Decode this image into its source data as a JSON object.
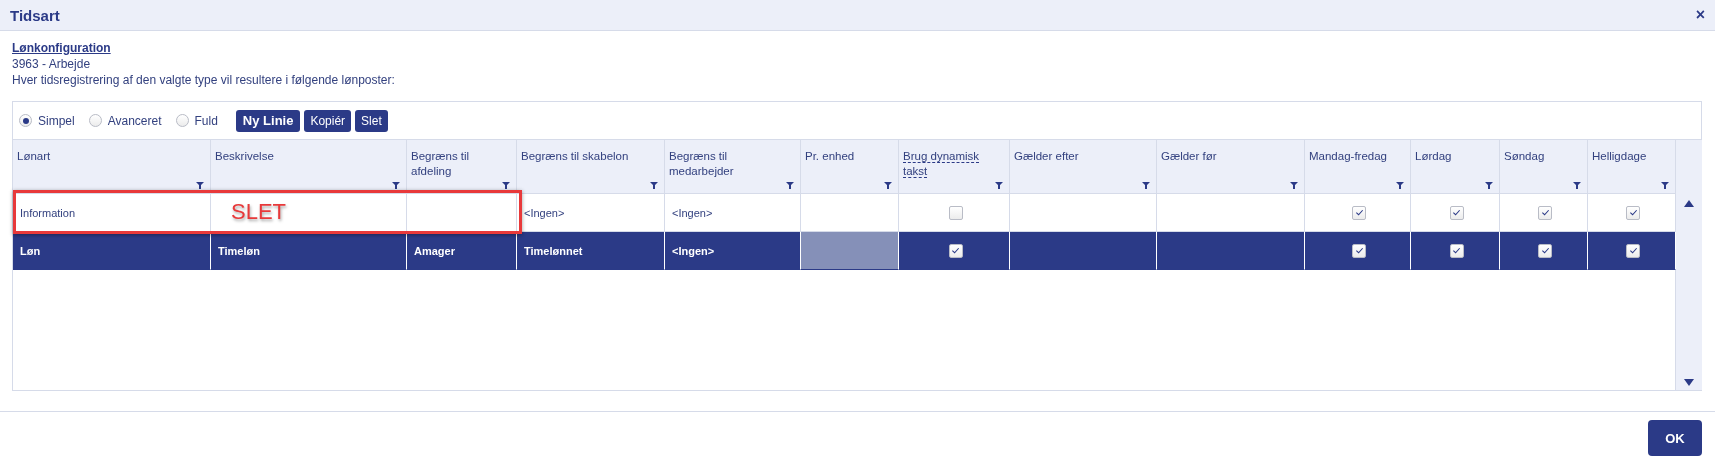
{
  "window": {
    "title": "Tidsart",
    "close": "×"
  },
  "config": {
    "heading": "Lønkonfiguration",
    "subtitle": "3963 - Arbejde",
    "description": "Hver tidsregistrering af den valgte type vil resultere i følgende lønposter:"
  },
  "modes": [
    {
      "label": "Simpel",
      "selected": true
    },
    {
      "label": "Avanceret",
      "selected": false
    },
    {
      "label": "Fuld",
      "selected": false
    }
  ],
  "toolbar_buttons": [
    {
      "label": "Ny Linie",
      "kind": "primary"
    },
    {
      "label": "Kopiér",
      "kind": "plain"
    },
    {
      "label": "Slet",
      "kind": "plain"
    }
  ],
  "table": {
    "columns": [
      {
        "label": "Lønart",
        "kind": "text",
        "hint": false
      },
      {
        "label": "Beskrivelse",
        "kind": "text",
        "hint": false
      },
      {
        "label": "Begræns til afdeling",
        "kind": "text",
        "hint": false
      },
      {
        "label": "Begræns til skabelon",
        "kind": "text",
        "hint": false
      },
      {
        "label": "Begræns til medarbejder",
        "kind": "text",
        "hint": false
      },
      {
        "label": "Pr. enhed",
        "kind": "text",
        "hint": false
      },
      {
        "label": "Brug dynamisk takst",
        "kind": "check",
        "hint": true
      },
      {
        "label": "Gælder efter",
        "kind": "text",
        "hint": false
      },
      {
        "label": "Gælder før",
        "kind": "text",
        "hint": false
      },
      {
        "label": "Mandag-fredag",
        "kind": "check",
        "hint": false
      },
      {
        "label": "Lørdag",
        "kind": "check",
        "hint": false
      },
      {
        "label": "Søndag",
        "kind": "check",
        "hint": false
      },
      {
        "label": "Helligdage",
        "kind": "check",
        "hint": false
      }
    ],
    "rows": [
      {
        "selected": false,
        "cells": [
          {
            "text": "Information"
          },
          {},
          {},
          {
            "text": "<Ingen>"
          },
          {
            "text": "<Ingen>"
          },
          {
            "active": false
          },
          {
            "checked": false
          },
          {},
          {},
          {
            "checked": true
          },
          {
            "checked": true
          },
          {
            "checked": true
          },
          {
            "checked": true
          }
        ]
      },
      {
        "selected": true,
        "cells": [
          {
            "text": "Løn"
          },
          {
            "text": "Timeløn"
          },
          {
            "text": "Amager"
          },
          {
            "text": "Timelønnet"
          },
          {
            "text": "<Ingen>"
          },
          {
            "active": true
          },
          {
            "checked": true
          },
          {},
          {},
          {
            "checked": true
          },
          {
            "checked": true
          },
          {
            "checked": true
          },
          {
            "checked": true
          }
        ]
      }
    ]
  },
  "annotation": {
    "text": "SLET"
  },
  "footer": {
    "button": "OK"
  }
}
